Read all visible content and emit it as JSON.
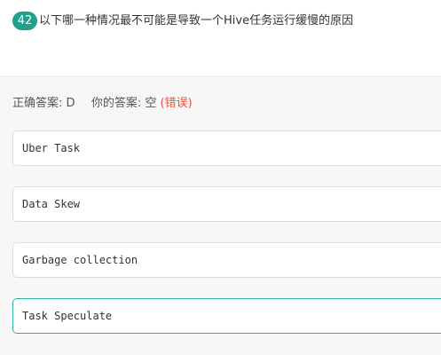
{
  "question": {
    "number": "42",
    "text": "以下哪一种情况最不可能是导致一个Hive任务运行缓慢的原因"
  },
  "result": {
    "correct_label": "正确答案:",
    "correct_value": "D",
    "your_label": "你的答案:",
    "your_value": "空",
    "status": "(错误)",
    "status_color": "#e8563d"
  },
  "options": [
    {
      "label": "Uber Task"
    },
    {
      "label": "Data Skew"
    },
    {
      "label": "Garbage collection"
    },
    {
      "label": "Task Speculate"
    }
  ],
  "colors": {
    "accent": "#1ea08b",
    "correct_border": "#27b29a"
  }
}
